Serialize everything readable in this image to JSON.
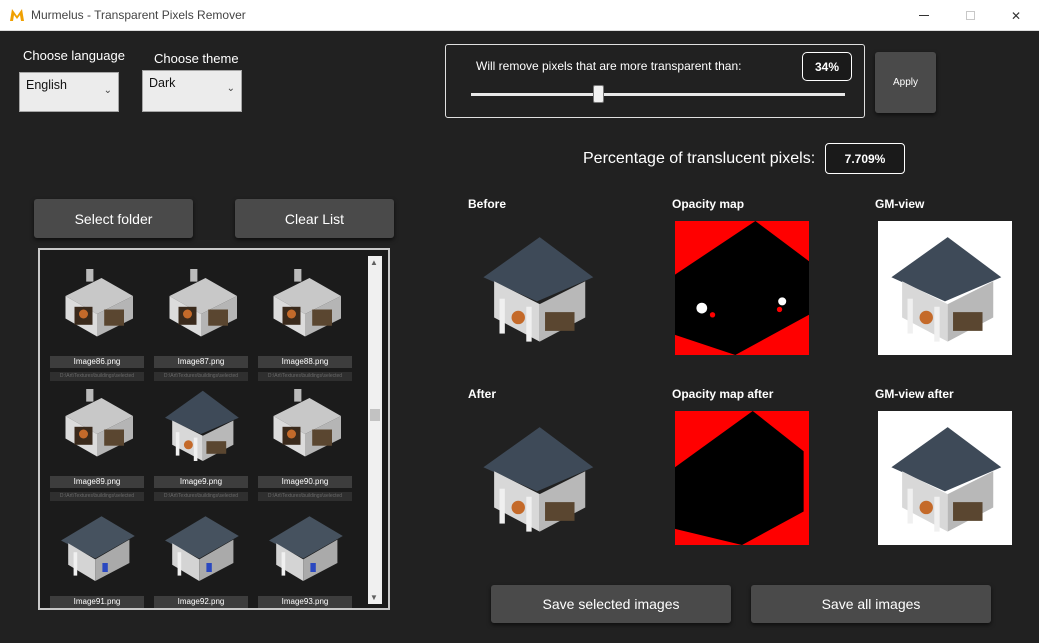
{
  "window": {
    "title": "Murmelus - Transparent Pixels Remover",
    "close_glyph": "✕"
  },
  "settings": {
    "language_label": "Choose language",
    "language_value": "English",
    "theme_label": "Choose theme",
    "theme_value": "Dark"
  },
  "threshold": {
    "text": "Will remove pixels that are more transparent than:",
    "value_label": "34%",
    "value": 0.34,
    "apply_label": "Apply"
  },
  "translucent": {
    "label": "Percentage of translucent pixels:",
    "value": "7.709%"
  },
  "list": {
    "select_folder_label": "Select folder",
    "clear_list_label": "Clear List",
    "items": [
      {
        "name": "Image86.png",
        "path": "D:\\Art\\Textures\\buildings\\selected"
      },
      {
        "name": "Image87.png",
        "path": "D:\\Art\\Textures\\buildings\\selected"
      },
      {
        "name": "Image88.png",
        "path": "D:\\Art\\Textures\\buildings\\selected"
      },
      {
        "name": "Image89.png",
        "path": "D:\\Art\\Textures\\buildings\\selected"
      },
      {
        "name": "Image9.png",
        "path": "D:\\Art\\Textures\\buildings\\selected"
      },
      {
        "name": "Image90.png",
        "path": "D:\\Art\\Textures\\buildings\\selected"
      },
      {
        "name": "Image91.png",
        "path": ""
      },
      {
        "name": "Image92.png",
        "path": ""
      },
      {
        "name": "Image93.png",
        "path": ""
      }
    ]
  },
  "previews": {
    "before": "Before",
    "opacity_map": "Opacity map",
    "gm_view": "GM-view",
    "after": "After",
    "opacity_map_after": "Opacity map after",
    "gm_view_after": "GM-view after"
  },
  "actions": {
    "save_selected_label": "Save selected images",
    "save_all_label": "Save all images"
  },
  "colors": {
    "background": "#212121",
    "button": "#4a4a4a",
    "accent_logo": "#f0a000",
    "opacity_red": "#ff0000"
  },
  "icons": [
    "app-logo-icon",
    "minimize-icon",
    "maximize-icon",
    "close-icon",
    "chevron-down-icon",
    "scroll-up-icon",
    "scroll-down-icon"
  ]
}
